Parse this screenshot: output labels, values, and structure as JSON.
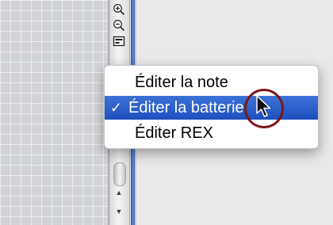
{
  "toolbar": {
    "icons": [
      "zoom-in-icon",
      "zoom-out-icon",
      "edit-mode-icon"
    ]
  },
  "scrollbar": {
    "up_glyph": "▲",
    "down_glyph": "▼"
  },
  "menu": {
    "items": [
      {
        "label": "Éditer la note",
        "checked": false
      },
      {
        "label": "Éditer la batterie",
        "checked": true,
        "check_mark": "✓"
      },
      {
        "label": "Éditer REX",
        "checked": false
      }
    ],
    "highlight_color": "#2a5bc6"
  },
  "colors": {
    "grid_background": "#d2d4d7",
    "panel_edge_blue": "#3b68b6",
    "cursor_ring": "#7b1818"
  }
}
